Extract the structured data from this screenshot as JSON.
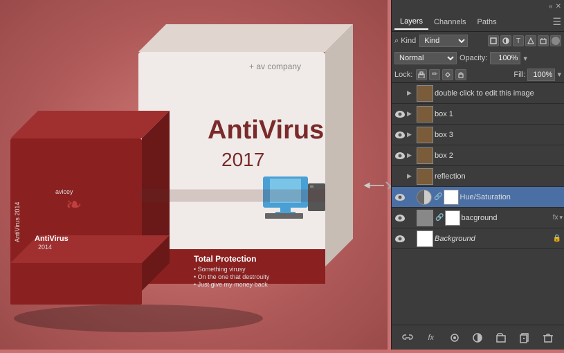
{
  "canvas": {
    "bg_color": "#c97070"
  },
  "panel": {
    "topbar": {
      "double_arrow": "«",
      "close": "✕"
    },
    "tabs": [
      {
        "label": "Layers",
        "active": true
      },
      {
        "label": "Channels",
        "active": false
      },
      {
        "label": "Paths",
        "active": false
      }
    ],
    "menu_icon": "☰",
    "filter": {
      "label": "⌕ Kind",
      "icons": [
        "T",
        "□",
        "T",
        "□",
        "□",
        "○"
      ]
    },
    "blend": {
      "mode": "Normal",
      "opacity_label": "Opacity:",
      "opacity_value": "100%"
    },
    "lock": {
      "label": "Lock:",
      "icons": [
        "□",
        "/",
        "✛",
        "🔒"
      ],
      "fill_label": "Fill:",
      "fill_value": "100%"
    },
    "layers": [
      {
        "id": "double-click-layer",
        "visible": false,
        "expanded": true,
        "is_folder": true,
        "name": "double click to edit this image",
        "has_fx": false,
        "locked": false,
        "selected": false
      },
      {
        "id": "box1-layer",
        "visible": true,
        "expanded": true,
        "is_folder": true,
        "name": "box 1",
        "has_fx": false,
        "locked": false,
        "selected": false
      },
      {
        "id": "box3-layer",
        "visible": true,
        "expanded": true,
        "is_folder": true,
        "name": "box 3",
        "has_fx": false,
        "locked": false,
        "selected": false
      },
      {
        "id": "box2-layer",
        "visible": true,
        "expanded": true,
        "is_folder": true,
        "name": "box 2",
        "has_fx": false,
        "locked": false,
        "selected": false
      },
      {
        "id": "reflection-layer",
        "visible": false,
        "expanded": true,
        "is_folder": true,
        "name": "reflection",
        "has_fx": false,
        "locked": false,
        "selected": false
      },
      {
        "id": "hue-saturation-layer",
        "visible": true,
        "expanded": false,
        "is_folder": false,
        "has_mask": true,
        "name": "Hue/Saturation",
        "has_fx": false,
        "locked": false,
        "selected": true,
        "thumb_type": "half-circle",
        "mask_type": "white"
      },
      {
        "id": "background-layer",
        "visible": true,
        "expanded": false,
        "is_folder": false,
        "has_mask": true,
        "name": "bacground",
        "has_fx": true,
        "locked": false,
        "selected": false,
        "thumb_type": "gray",
        "mask_type": "white"
      },
      {
        "id": "bg-layer",
        "visible": true,
        "expanded": false,
        "is_folder": false,
        "has_mask": false,
        "name": "Background",
        "has_fx": false,
        "locked": true,
        "selected": false,
        "thumb_type": "white",
        "italic": true
      }
    ],
    "bottom_buttons": [
      "🔗",
      "fx",
      "●",
      "⊘",
      "□",
      "🗑"
    ]
  }
}
